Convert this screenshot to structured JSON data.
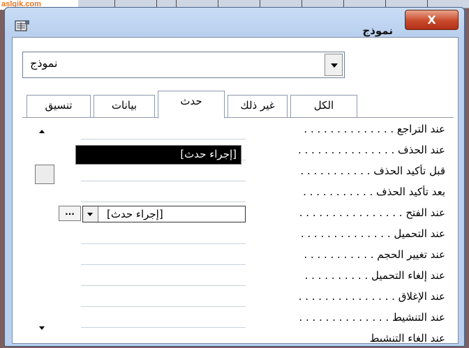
{
  "watermark": "aslgik.com",
  "window": {
    "title": "نموذج",
    "close_symbol": "X"
  },
  "object_selector": {
    "value": "نموذج"
  },
  "tabs": [
    {
      "label": "الكل",
      "active": false
    },
    {
      "label": "غير ذلك",
      "active": false
    },
    {
      "label": "حدث",
      "active": true
    },
    {
      "label": "بيانات",
      "active": false
    },
    {
      "label": "تنسيق",
      "active": false
    }
  ],
  "properties": [
    {
      "label": "عند التراجع . . . . . . . . . . . . . .",
      "value": ""
    },
    {
      "label": "عند الحذف . . . . . . . . . . . . . . .",
      "value": ""
    },
    {
      "label": "قبل تأكيد الحذف . . . . . . . . . . .",
      "value": ""
    },
    {
      "label": "بعد تأكيد الحذف . . . . . . . . . . .",
      "value": ""
    },
    {
      "label": "عند الفتح . . . . . . . . . . . . . . . .",
      "value": "[إجراء حدث]"
    },
    {
      "label": "عند التحميل . . . . . . . . . . . . . .",
      "value": ""
    },
    {
      "label": "عند تغيير الحجم . . . . . . . . . . .",
      "value": ""
    },
    {
      "label": "عند إلغاء التحميل . . . . . . . . . .",
      "value": ""
    },
    {
      "label": "عند الإغلاق . . . . . . . . . . . . . . .",
      "value": ""
    },
    {
      "label": "عند التنشيط . . . . . . . . . . . . . .",
      "value": ""
    },
    {
      "label": "عند إلغاء التنشيط",
      "value": ""
    }
  ],
  "active_field": {
    "value": "[إجراء حدث]",
    "builder_label": "..."
  },
  "dropdown": {
    "options": [
      "[إجراء حدث]"
    ]
  }
}
